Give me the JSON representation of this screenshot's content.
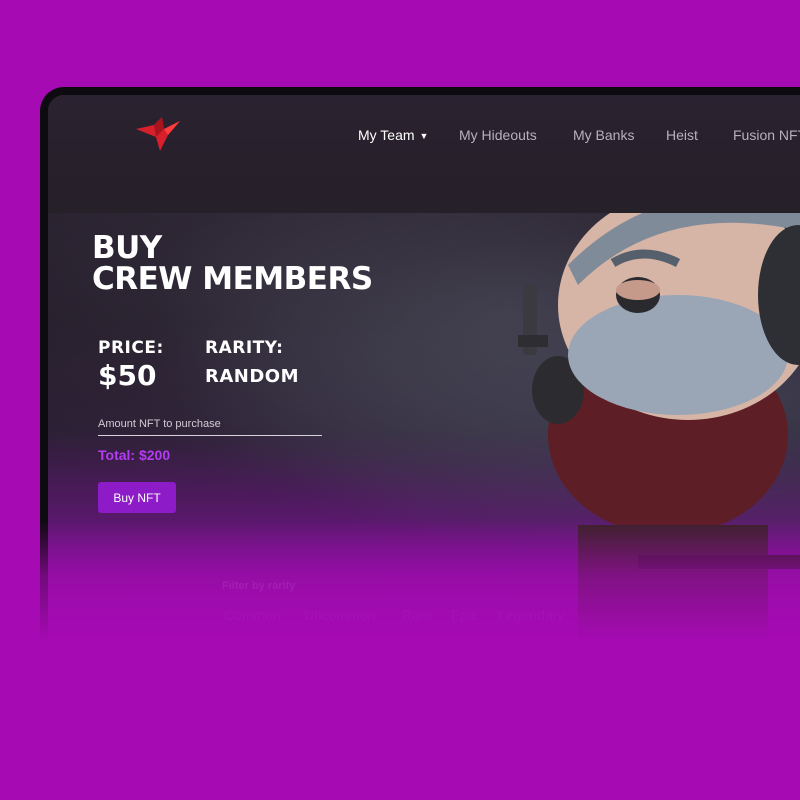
{
  "nav": {
    "items": [
      {
        "label": "My Team",
        "has_dropdown": true,
        "active": true
      },
      {
        "label": "My Hideouts"
      },
      {
        "label": "My Banks"
      },
      {
        "label": "Heist"
      },
      {
        "label": "Fusion NFT"
      }
    ]
  },
  "hero": {
    "title_line1": "BUY",
    "title_line2": "CREW MEMBERS"
  },
  "price": {
    "label": "PRICE:",
    "value": "$50"
  },
  "rarity": {
    "label": "RARITY:",
    "value": "RANDOM"
  },
  "amount_input": {
    "placeholder": "Amount NFT to purchase",
    "value": ""
  },
  "total": "Total: $200",
  "buy_button": "Buy NFT",
  "filter": {
    "label": "Filter by rarity",
    "options": [
      "Common",
      "Uncommon",
      "Rare",
      "Epic",
      "Legendary"
    ]
  },
  "colors": {
    "page_background": "#a50ab3",
    "accent_purple": "#8d1bc7",
    "total_text": "#b43cf2",
    "logo_red": "#d8202c"
  },
  "icons": [
    "bird-logo-icon",
    "caret-down-icon"
  ]
}
